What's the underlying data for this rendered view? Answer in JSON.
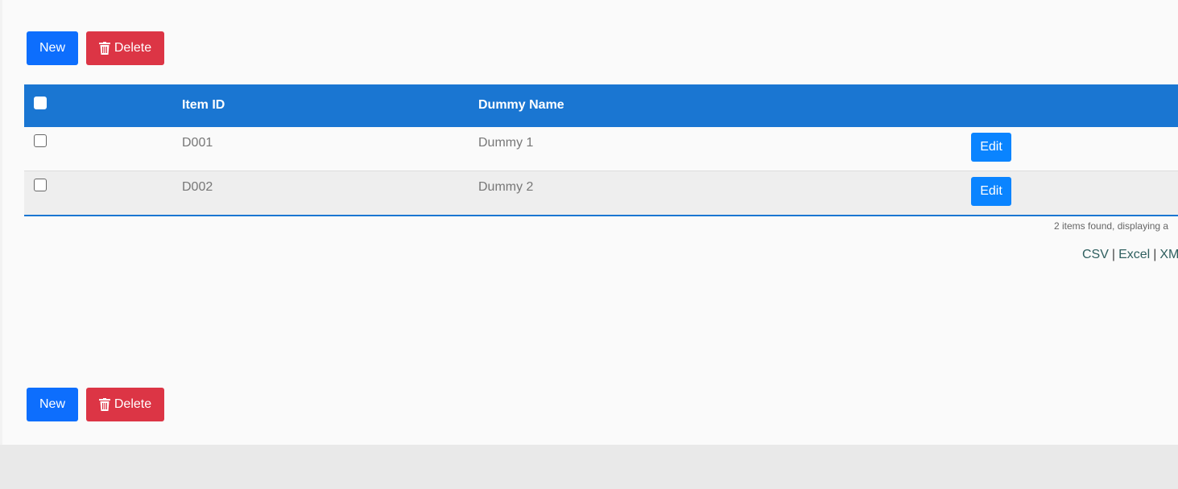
{
  "toolbar": {
    "new_label": "New",
    "delete_label": "Delete"
  },
  "table": {
    "columns": [
      "Item ID",
      "Dummy Name"
    ],
    "rows": [
      {
        "item_id": "D001",
        "dummy_name": "Dummy 1",
        "edit_label": "Edit"
      },
      {
        "item_id": "D002",
        "dummy_name": "Dummy 2",
        "edit_label": "Edit"
      }
    ]
  },
  "footer": {
    "summary": "2 items found, displaying a",
    "exports": [
      "CSV",
      "Excel",
      "XM"
    ],
    "separator": "|"
  },
  "colors": {
    "primary": "#0d6efd",
    "danger": "#dc3545",
    "header": "#1a76d2"
  },
  "icons": {
    "delete": "trash-icon"
  }
}
